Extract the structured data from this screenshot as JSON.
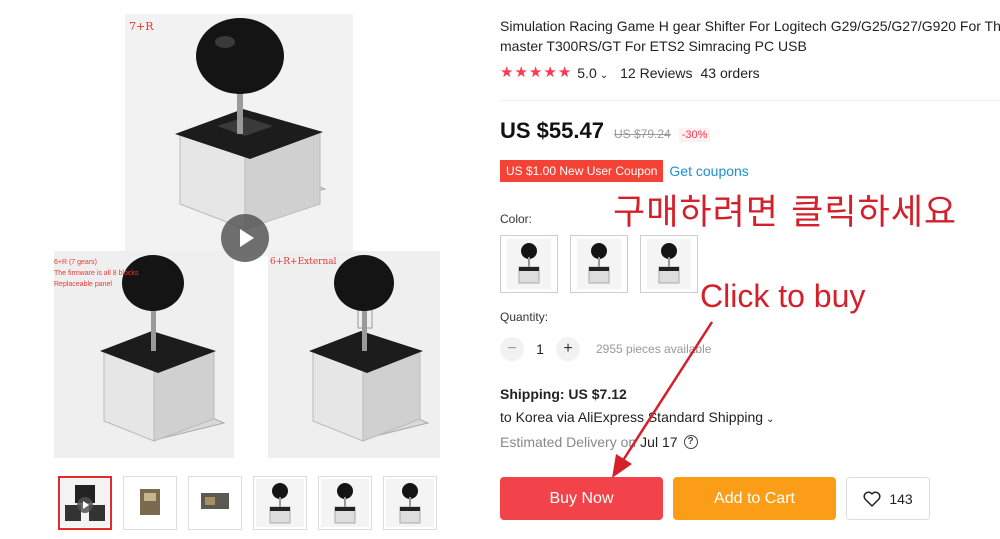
{
  "gallery": {
    "main_caption": "7+R",
    "left_caption_line1": "6+R (7 gears)",
    "left_caption_line2": "The firmware is all 8 blocks",
    "left_caption_line3": "Replaceable panel",
    "right_caption": "6+R+External",
    "play_icon": "play-icon",
    "thumbnails": [
      "video-thumb",
      "product-thumb",
      "product-thumb",
      "product-thumb",
      "product-thumb",
      "product-thumb"
    ],
    "active_thumb_index": 0
  },
  "product": {
    "title_line1": "Simulation Racing Game H gear Shifter For Logitech G29/G25/G27/G920 For Thrust",
    "title_line2": "master T300RS/GT For ETS2 Simracing PC USB",
    "rating_stars": 5,
    "rating_value": "5.0",
    "reviews": "12 Reviews",
    "orders": "43 orders",
    "price": "US $55.47",
    "old_price": "US $79.24",
    "discount": "-30%",
    "coupon": "US $1.00 New User Coupon",
    "get_coupons": "Get coupons",
    "color_label": "Color:",
    "quantity_label": "Quantity:",
    "quantity": "1",
    "available": "2955 pieces available",
    "shipping": "Shipping: US $7.12",
    "shipping_via": "to Korea via AliExpress Standard Shipping",
    "estimated_label": "Estimated Delivery on",
    "estimated_date": "Jul 17",
    "buy_now": "Buy Now",
    "add_to_cart": "Add to Cart",
    "wishlist_count": "143"
  },
  "overlay": {
    "korean_text": "구매하려면 클릭하세요",
    "english_text": "Click to buy",
    "color": "#d3202a"
  },
  "colors": {
    "accent_red": "#f3434a",
    "cart_orange": "#fb9d16",
    "star_red": "#fd384f",
    "link_blue": "#1b8fd0"
  }
}
